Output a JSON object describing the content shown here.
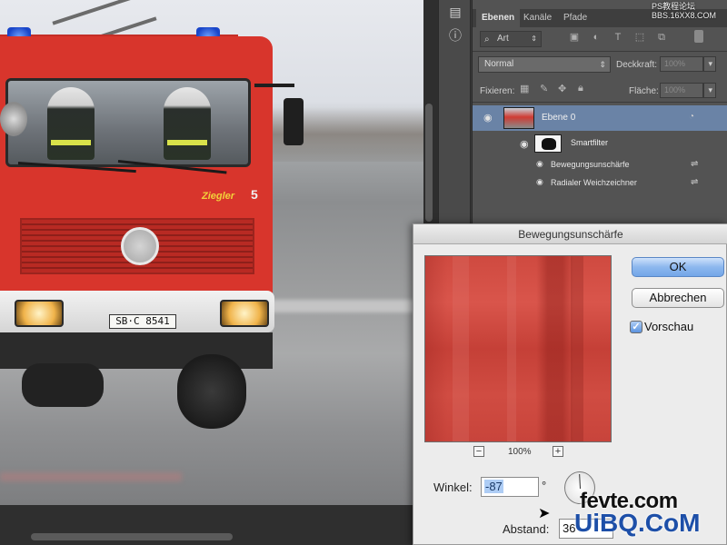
{
  "canvas": {
    "plate_text": "SB·C 8541",
    "brand_text": "Ziegler",
    "unit_number": "5"
  },
  "tools": {
    "icons": [
      "history-icon",
      "info-icon"
    ]
  },
  "layers_panel": {
    "tabs": [
      {
        "label": "Ebenen",
        "active": true
      },
      {
        "label": "Kanäle",
        "active": false
      },
      {
        "label": "Pfade",
        "active": false
      }
    ],
    "kind_filter": "Art",
    "blend_mode": "Normal",
    "opacity_label": "Deckkraft:",
    "opacity_value": "100%",
    "lock_label": "Fixieren:",
    "fill_label": "Fläche:",
    "fill_value": "100%",
    "layers": [
      {
        "name": "Ebene 0",
        "selected": true
      },
      {
        "name": "Smartfilter",
        "selected": false
      }
    ],
    "smart_filters": [
      {
        "name": "Bewegungsunschärfe"
      },
      {
        "name": "Radialer Weichzeichner"
      }
    ]
  },
  "dialog": {
    "title": "Bewegungsunschärfe",
    "ok_label": "OK",
    "cancel_label": "Abbrechen",
    "preview_label": "Vorschau",
    "preview_checked": true,
    "zoom_minus": "−",
    "zoom_plus": "+",
    "zoom_level": "100%",
    "angle_label": "Winkel:",
    "angle_value": "-87",
    "angle_unit": "°",
    "distance_label": "Abstand:",
    "distance_value": "36"
  },
  "watermarks": {
    "top_line1": "PS教程论坛",
    "top_line2": "BBS.16XX8.COM",
    "bottom_line1": "fevte.com",
    "bottom_line2": "UiBQ.CoM"
  },
  "colors": {
    "selection_blue": "#6a83a6",
    "ok_button": "#73a6e8",
    "panel_bg": "#535353"
  }
}
